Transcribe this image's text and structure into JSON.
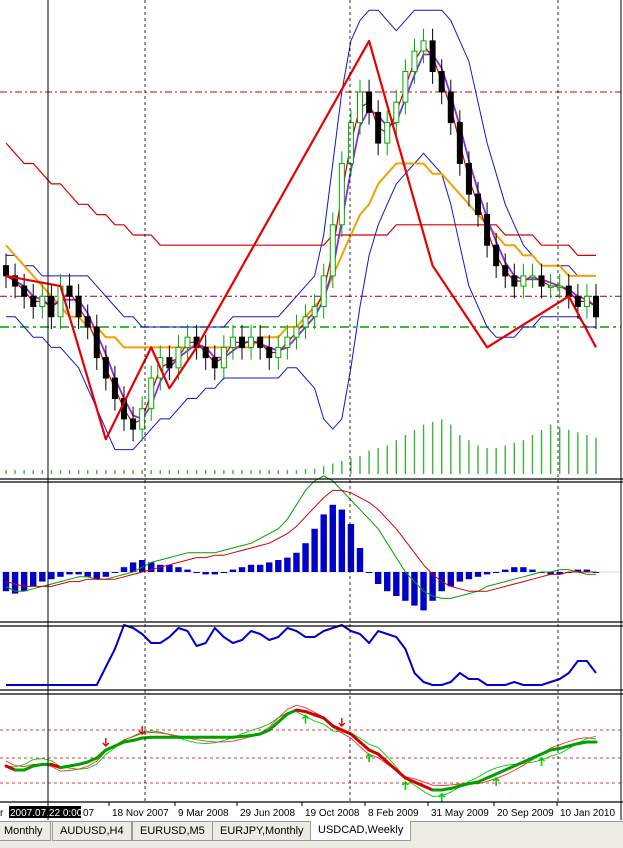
{
  "chart_data": [
    {
      "type": "candlestick",
      "title": "",
      "symbol": "USDCAD",
      "timeframe": "Weekly",
      "x_tick_labels": [
        "2007.07.22 0:00",
        "18 Nov 2007",
        "9 Mar 2008",
        "29 Jun 2008",
        "19 Oct 2008",
        "8 Feb 2009",
        "31 May 2009",
        "20 Sep 2009",
        "10 Jan 2010"
      ],
      "x_tick_label_left_partial": "r",
      "x_tick_label_cursor_suffix": "07",
      "series": [
        {
          "id": "close",
          "values": [
            1.07,
            1.06,
            1.05,
            1.04,
            1.05,
            1.03,
            1.06,
            1.05,
            1.03,
            1.02,
            0.99,
            0.97,
            0.95,
            0.93,
            0.92,
            0.94,
            0.97,
            0.99,
            0.98,
            1.0,
            1.01,
            1.0,
            0.99,
            0.98,
            1.0,
            1.01,
            1.0,
            1.01,
            1.0,
            0.99,
            1.0,
            1.01,
            1.02,
            1.03,
            1.04,
            1.07,
            1.12,
            1.18,
            1.22,
            1.25,
            1.23,
            1.2,
            1.22,
            1.24,
            1.27,
            1.29,
            1.3,
            1.27,
            1.25,
            1.22,
            1.18,
            1.15,
            1.13,
            1.1,
            1.08,
            1.07,
            1.06,
            1.07,
            1.07,
            1.06,
            1.06,
            1.06,
            1.05,
            1.04,
            1.05,
            1.03
          ]
        },
        {
          "id": "bollinger_upper",
          "values": [
            1.09,
            1.09,
            1.08,
            1.08,
            1.07,
            1.07,
            1.07,
            1.07,
            1.07,
            1.07,
            1.06,
            1.05,
            1.04,
            1.03,
            1.03,
            1.02,
            1.02,
            1.02,
            1.02,
            1.02,
            1.02,
            1.02,
            1.02,
            1.02,
            1.02,
            1.03,
            1.03,
            1.03,
            1.03,
            1.03,
            1.03,
            1.04,
            1.05,
            1.06,
            1.07,
            1.11,
            1.18,
            1.25,
            1.3,
            1.32,
            1.33,
            1.33,
            1.32,
            1.31,
            1.32,
            1.33,
            1.33,
            1.33,
            1.33,
            1.32,
            1.3,
            1.28,
            1.24,
            1.2,
            1.17,
            1.14,
            1.12,
            1.1,
            1.09,
            1.08,
            1.08,
            1.08,
            1.08,
            1.07,
            1.07,
            1.07
          ]
        },
        {
          "id": "bollinger_lower",
          "values": [
            1.03,
            1.03,
            1.02,
            1.01,
            1.01,
            1.0,
            1.0,
            0.99,
            0.98,
            0.96,
            0.94,
            0.92,
            0.9,
            0.9,
            0.9,
            0.91,
            0.92,
            0.93,
            0.93,
            0.94,
            0.95,
            0.95,
            0.96,
            0.96,
            0.97,
            0.97,
            0.97,
            0.97,
            0.97,
            0.97,
            0.97,
            0.98,
            0.98,
            0.97,
            0.96,
            0.93,
            0.92,
            0.93,
            0.98,
            1.04,
            1.09,
            1.12,
            1.14,
            1.16,
            1.17,
            1.18,
            1.19,
            1.18,
            1.17,
            1.14,
            1.1,
            1.06,
            1.04,
            1.02,
            1.01,
            1.01,
            1.01,
            1.02,
            1.02,
            1.03,
            1.03,
            1.03,
            1.03,
            1.03,
            1.02,
            1.02
          ]
        },
        {
          "id": "ma_orange",
          "values": [
            1.1,
            1.09,
            1.08,
            1.07,
            1.06,
            1.05,
            1.04,
            1.03,
            1.03,
            1.02,
            1.02,
            1.01,
            1.01,
            1.0,
            1.0,
            1.0,
            1.0,
            1.0,
            1.0,
            1.0,
            1.0,
            1.0,
            1.0,
            1.0,
            1.0,
            1.0,
            1.0,
            1.0,
            1.01,
            1.01,
            1.01,
            1.02,
            1.02,
            1.03,
            1.04,
            1.05,
            1.07,
            1.09,
            1.11,
            1.13,
            1.14,
            1.16,
            1.17,
            1.18,
            1.18,
            1.18,
            1.18,
            1.17,
            1.17,
            1.16,
            1.15,
            1.14,
            1.13,
            1.12,
            1.11,
            1.1,
            1.1,
            1.09,
            1.09,
            1.08,
            1.08,
            1.08,
            1.07,
            1.07,
            1.07,
            1.07
          ]
        },
        {
          "id": "ma_red_long",
          "values": [
            1.2,
            1.19,
            1.18,
            1.18,
            1.17,
            1.16,
            1.16,
            1.15,
            1.14,
            1.14,
            1.13,
            1.13,
            1.12,
            1.12,
            1.11,
            1.11,
            1.11,
            1.1,
            1.1,
            1.1,
            1.1,
            1.1,
            1.1,
            1.1,
            1.1,
            1.1,
            1.1,
            1.1,
            1.1,
            1.1,
            1.1,
            1.1,
            1.1,
            1.1,
            1.1,
            1.1,
            1.11,
            1.11,
            1.11,
            1.11,
            1.11,
            1.11,
            1.11,
            1.12,
            1.12,
            1.12,
            1.12,
            1.12,
            1.12,
            1.12,
            1.12,
            1.12,
            1.12,
            1.12,
            1.12,
            1.11,
            1.11,
            1.11,
            1.11,
            1.1,
            1.1,
            1.1,
            1.1,
            1.09,
            1.09,
            1.09
          ]
        },
        {
          "id": "zigzag",
          "points": [
            [
              0,
              1.07
            ],
            [
              6,
              1.06
            ],
            [
              11,
              0.91
            ],
            [
              16,
              1.0
            ],
            [
              18,
              0.96
            ],
            [
              21,
              1.0
            ],
            [
              40,
              1.3
            ],
            [
              47,
              1.08
            ],
            [
              53,
              1.0
            ],
            [
              62,
              1.05
            ],
            [
              65,
              1.0
            ]
          ]
        },
        {
          "id": "volume",
          "values": [
            3,
            3,
            3,
            3,
            3,
            3,
            3,
            3,
            3,
            3,
            3,
            3,
            3,
            3,
            3,
            3,
            3,
            3,
            3,
            3,
            3,
            3,
            3,
            3,
            3,
            3,
            3,
            3,
            3,
            3,
            3,
            3,
            3,
            4,
            4,
            6,
            8,
            10,
            12,
            14,
            18,
            20,
            22,
            26,
            30,
            34,
            38,
            40,
            42,
            38,
            30,
            26,
            22,
            20,
            20,
            22,
            24,
            26,
            30,
            34,
            38,
            36,
            34,
            32,
            30,
            28
          ]
        },
        {
          "id": "macd_hist",
          "values": [
            -8,
            -9,
            -8,
            -6,
            -4,
            -3,
            -2,
            -1,
            -1,
            -2,
            -3,
            -2,
            0,
            2,
            4,
            5,
            4,
            3,
            3,
            2,
            1,
            0,
            -1,
            -1,
            0,
            1,
            2,
            3,
            3,
            4,
            5,
            6,
            8,
            12,
            18,
            24,
            28,
            26,
            20,
            10,
            0,
            -5,
            -8,
            -10,
            -12,
            -14,
            -16,
            -12,
            -8,
            -6,
            -4,
            -3,
            -2,
            -1,
            0,
            1,
            2,
            2,
            1,
            0,
            -1,
            -1,
            0,
            1,
            1,
            0
          ]
        },
        {
          "id": "macd_main",
          "values": [
            -6,
            -8,
            -8,
            -7,
            -6,
            -5,
            -4,
            -3,
            -2,
            -2,
            -3,
            -3,
            -2,
            -1,
            0,
            2,
            4,
            5,
            6,
            7,
            8,
            8,
            8,
            8,
            9,
            10,
            11,
            12,
            14,
            16,
            18,
            22,
            28,
            34,
            38,
            40,
            38,
            34,
            30,
            26,
            22,
            18,
            12,
            6,
            0,
            -4,
            -8,
            -10,
            -11,
            -11,
            -10,
            -9,
            -8,
            -6,
            -5,
            -4,
            -3,
            -2,
            -1,
            0,
            0,
            1,
            1,
            0,
            -1,
            -1
          ]
        },
        {
          "id": "macd_signal",
          "values": [
            -4,
            -5,
            -6,
            -6,
            -6,
            -6,
            -5,
            -4,
            -4,
            -3,
            -3,
            -3,
            -3,
            -2,
            -1,
            0,
            1,
            2,
            3,
            4,
            5,
            6,
            6,
            7,
            7,
            8,
            9,
            10,
            11,
            12,
            14,
            16,
            19,
            23,
            27,
            31,
            34,
            34,
            33,
            31,
            29,
            26,
            22,
            18,
            13,
            8,
            3,
            -1,
            -4,
            -6,
            -7,
            -8,
            -8,
            -8,
            -7,
            -6,
            -5,
            -4,
            -3,
            -2,
            -1,
            -1,
            0,
            0,
            0,
            0
          ]
        },
        {
          "id": "stoch_blue",
          "values": [
            0,
            0,
            0,
            0,
            0,
            0,
            0,
            0,
            0,
            0,
            0,
            30,
            60,
            100,
            95,
            85,
            70,
            70,
            80,
            95,
            90,
            65,
            70,
            95,
            80,
            70,
            75,
            90,
            85,
            75,
            80,
            95,
            90,
            80,
            80,
            90,
            95,
            100,
            90,
            85,
            70,
            90,
            85,
            80,
            60,
            20,
            5,
            0,
            0,
            5,
            20,
            10,
            10,
            0,
            0,
            0,
            5,
            0,
            0,
            0,
            5,
            10,
            20,
            40,
            40,
            20
          ]
        },
        {
          "id": "osc_lower",
          "values": [
            -10,
            -15,
            -15,
            -10,
            -8,
            -8,
            -12,
            -10,
            -8,
            -5,
            0,
            10,
            15,
            20,
            22,
            25,
            26,
            26,
            26,
            26,
            26,
            26,
            26,
            26,
            26,
            26,
            27,
            28,
            30,
            35,
            45,
            55,
            60,
            58,
            54,
            50,
            40,
            35,
            30,
            20,
            10,
            5,
            -5,
            -15,
            -25,
            -30,
            -35,
            -40,
            -40,
            -38,
            -35,
            -32,
            -30,
            -25,
            -20,
            -15,
            -10,
            -5,
            0,
            5,
            10,
            12,
            15,
            18,
            20,
            20
          ]
        }
      ],
      "signal_arrows": {
        "down": [
          11,
          15,
          37
        ],
        "up": [
          33,
          40,
          44,
          48,
          54,
          59
        ]
      },
      "horizontal_levels": {
        "resistance": 1.25,
        "mid": 1.05,
        "support": 1.02
      },
      "grid": "vertical dashed",
      "legend": "none"
    }
  ],
  "tabs": [
    "Monthly",
    "AUDUSD,H4",
    "EURUSD,M5",
    "EURJPY,Monthly",
    "USDCAD,Weekly"
  ],
  "active_tab": "USDCAD,Weekly",
  "colors": {
    "background": "#ffffff",
    "bull_candle": "#00aa00",
    "bear_candle": "#000000",
    "bollinger": "#1515c8",
    "ma_orange": "#f5a000",
    "ma_red": "#d40000",
    "zigzag": "#e60000",
    "volume": "#3cb43c",
    "macd_hist": "#0000c8",
    "macd_main": "#00a000",
    "macd_signal": "#d40000",
    "stoch": "#0000c8",
    "osc_bull": "#00a000",
    "osc_bear": "#d40000",
    "level_line": "#cc0000",
    "support_line": "#00a000"
  }
}
